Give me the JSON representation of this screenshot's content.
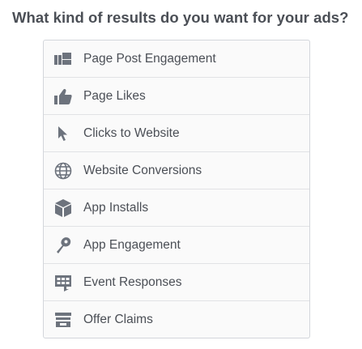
{
  "header": {
    "question": "What kind of results do you want for your ads?"
  },
  "objectives": [
    {
      "label": "Page Post Engagement",
      "icon": "post-engagement-icon"
    },
    {
      "label": "Page Likes",
      "icon": "thumbs-up-icon"
    },
    {
      "label": "Clicks to Website",
      "icon": "cursor-icon"
    },
    {
      "label": "Website Conversions",
      "icon": "globe-icon"
    },
    {
      "label": "App Installs",
      "icon": "cube-icon"
    },
    {
      "label": "App Engagement",
      "icon": "gamepad-icon"
    },
    {
      "label": "Event Responses",
      "icon": "calendar-icon"
    },
    {
      "label": "Offer Claims",
      "icon": "offer-icon"
    }
  ],
  "colors": {
    "text": "#4b4f56",
    "icon": "#6d737d",
    "list_background": "#fafafa",
    "border": "#d3d6db"
  }
}
